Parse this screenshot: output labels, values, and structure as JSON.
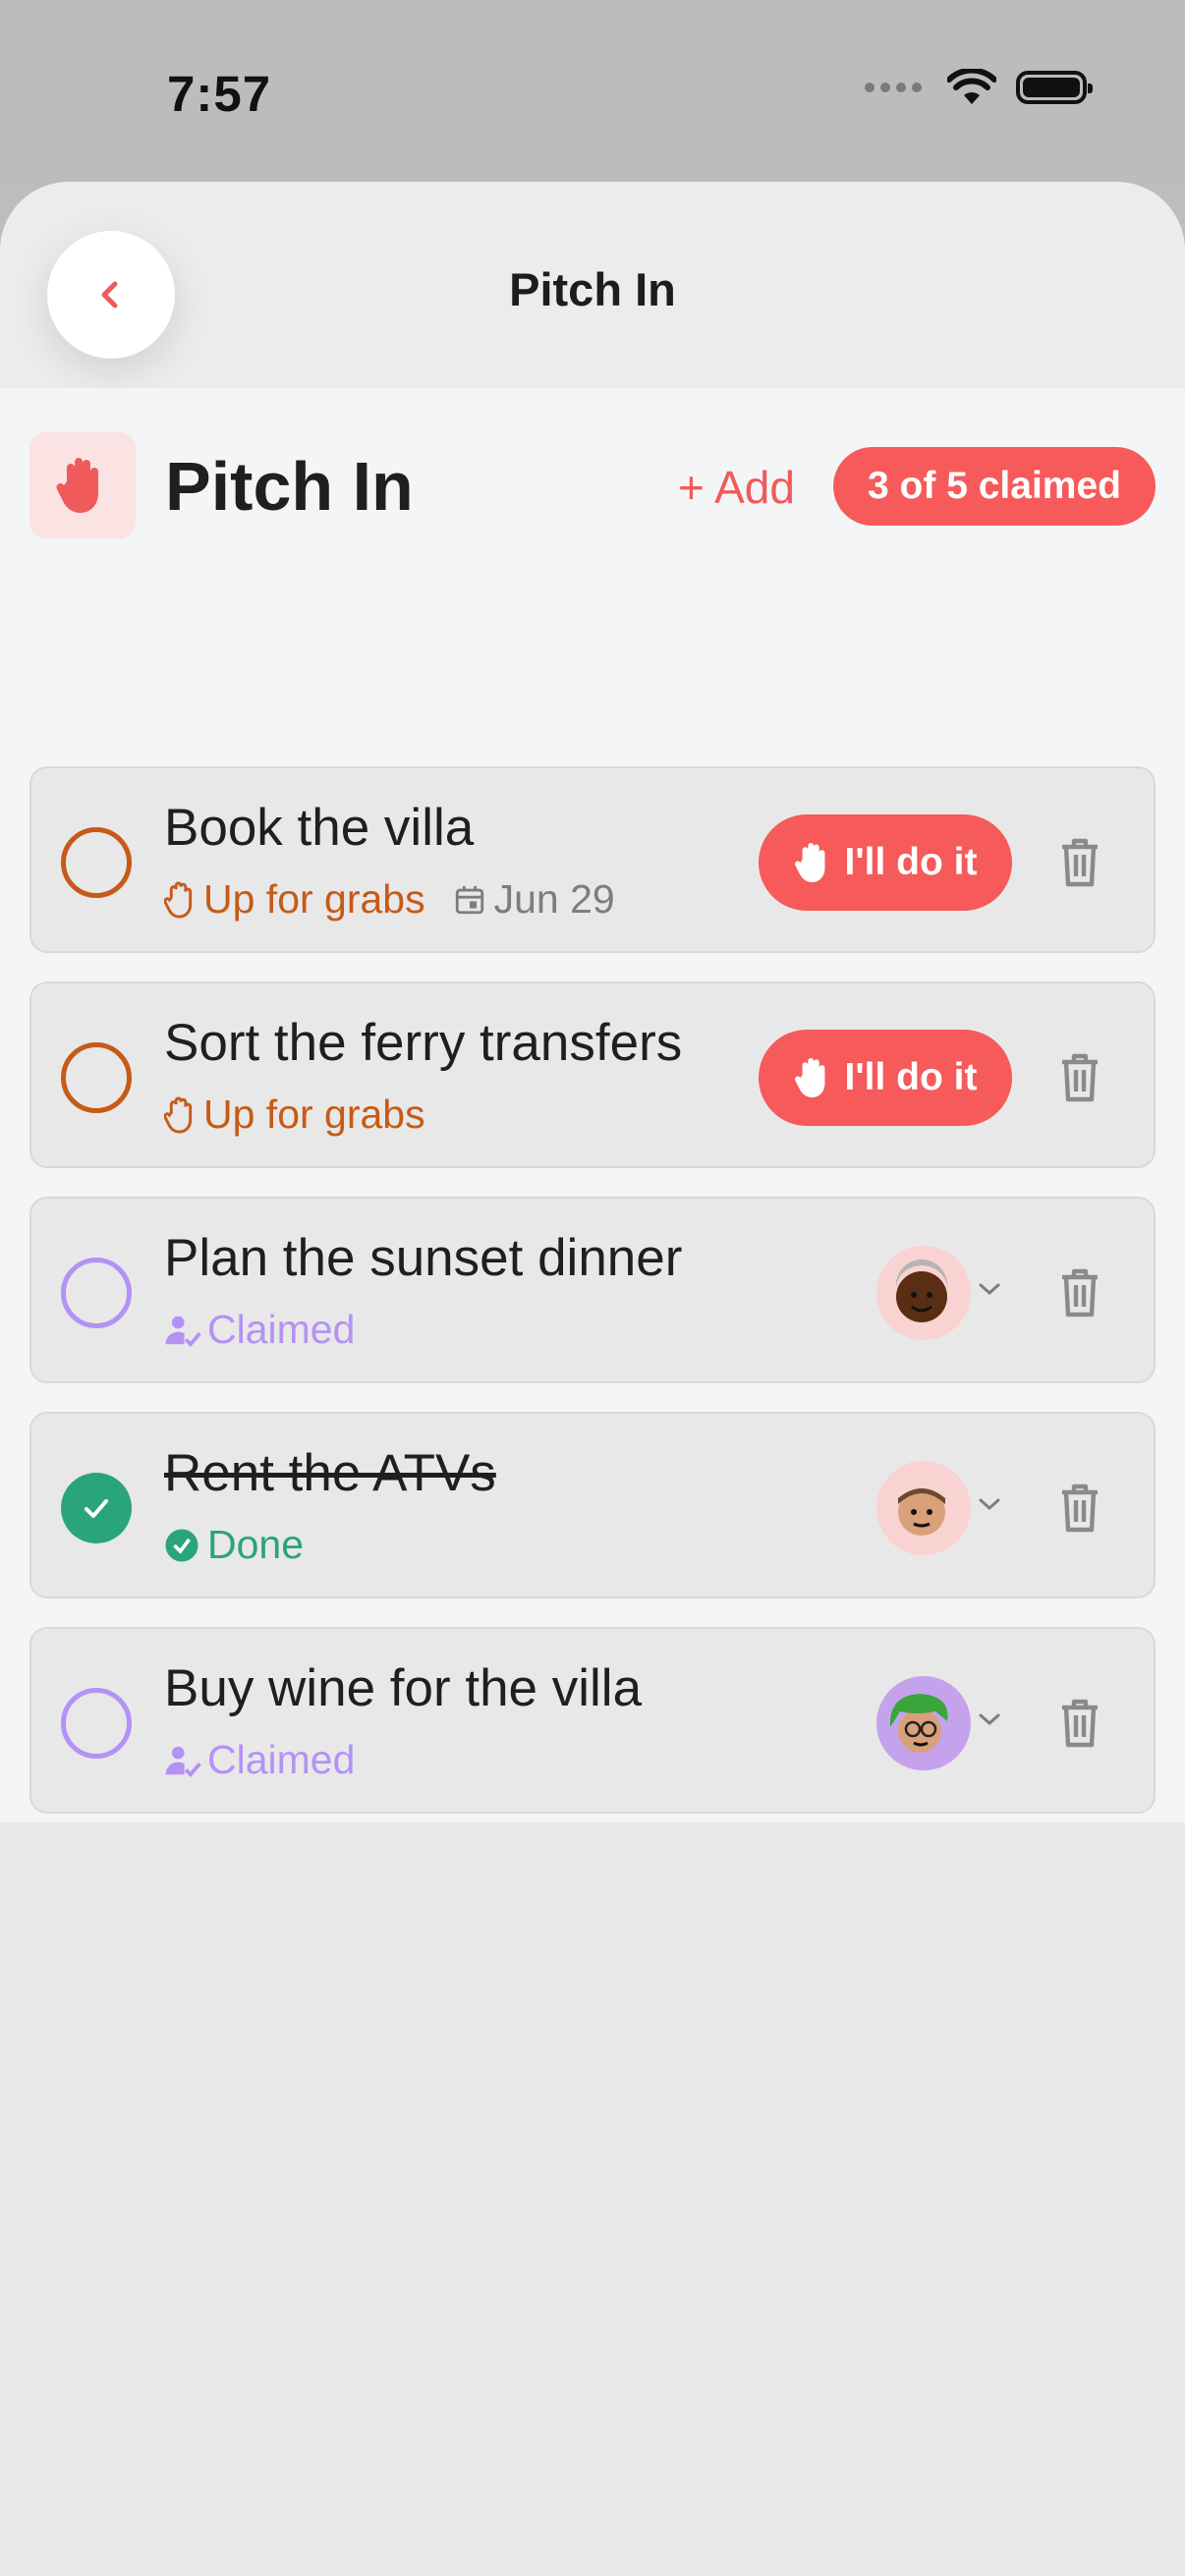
{
  "status_bar": {
    "time": "7:57"
  },
  "header": {
    "title": "Pitch In",
    "back_icon": "chevron-left-icon"
  },
  "section": {
    "icon": "hand-icon",
    "title": "Pitch In",
    "add_label": "+ Add",
    "claimed_badge": "3 of 5 claimed"
  },
  "tasks": [
    {
      "title": "Book the villa",
      "status": "Up for grabs",
      "date": "Jun 29",
      "action_label": "I'll do it",
      "state": "open"
    },
    {
      "title": "Sort the ferry transfers",
      "status": "Up for grabs",
      "action_label": "I'll do it",
      "state": "open"
    },
    {
      "title": "Plan the sunset dinner",
      "status": "Claimed",
      "state": "claimed",
      "avatar": "avatar-dark-skin-headband"
    },
    {
      "title": "Rent the ATVs",
      "status": "Done",
      "state": "done",
      "avatar": "avatar-light-skin-brown-hair"
    },
    {
      "title": "Buy wine for the villa",
      "status": "Claimed",
      "state": "claimed",
      "avatar": "avatar-green-hair-glasses"
    }
  ],
  "colors": {
    "accent": "#f65a5a",
    "open": "#c65a17",
    "claimed": "#b492f5",
    "done": "#2aa47b"
  }
}
